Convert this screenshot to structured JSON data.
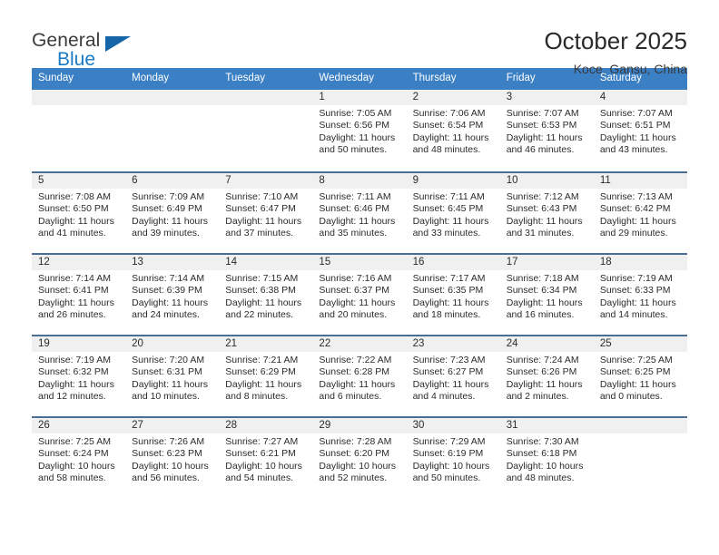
{
  "brand": {
    "line1": "General",
    "line2": "Blue",
    "triangle_color": "#1565a8",
    "blue_color": "#1b7ac4"
  },
  "header": {
    "title": "October 2025",
    "subtitle": "Koce, Gansu, China"
  },
  "theme": {
    "header_blue": "#3b7fc4",
    "row_divider": "#4a6f92",
    "daynum_band": "#f0f0f0"
  },
  "calendar": {
    "weekdays": [
      "Sunday",
      "Monday",
      "Tuesday",
      "Wednesday",
      "Thursday",
      "Friday",
      "Saturday"
    ],
    "weeks": [
      [
        {
          "day": "",
          "lines": []
        },
        {
          "day": "",
          "lines": []
        },
        {
          "day": "",
          "lines": []
        },
        {
          "day": "1",
          "lines": [
            "Sunrise: 7:05 AM",
            "Sunset: 6:56 PM",
            "Daylight: 11 hours",
            "and 50 minutes."
          ]
        },
        {
          "day": "2",
          "lines": [
            "Sunrise: 7:06 AM",
            "Sunset: 6:54 PM",
            "Daylight: 11 hours",
            "and 48 minutes."
          ]
        },
        {
          "day": "3",
          "lines": [
            "Sunrise: 7:07 AM",
            "Sunset: 6:53 PM",
            "Daylight: 11 hours",
            "and 46 minutes."
          ]
        },
        {
          "day": "4",
          "lines": [
            "Sunrise: 7:07 AM",
            "Sunset: 6:51 PM",
            "Daylight: 11 hours",
            "and 43 minutes."
          ]
        }
      ],
      [
        {
          "day": "5",
          "lines": [
            "Sunrise: 7:08 AM",
            "Sunset: 6:50 PM",
            "Daylight: 11 hours",
            "and 41 minutes."
          ]
        },
        {
          "day": "6",
          "lines": [
            "Sunrise: 7:09 AM",
            "Sunset: 6:49 PM",
            "Daylight: 11 hours",
            "and 39 minutes."
          ]
        },
        {
          "day": "7",
          "lines": [
            "Sunrise: 7:10 AM",
            "Sunset: 6:47 PM",
            "Daylight: 11 hours",
            "and 37 minutes."
          ]
        },
        {
          "day": "8",
          "lines": [
            "Sunrise: 7:11 AM",
            "Sunset: 6:46 PM",
            "Daylight: 11 hours",
            "and 35 minutes."
          ]
        },
        {
          "day": "9",
          "lines": [
            "Sunrise: 7:11 AM",
            "Sunset: 6:45 PM",
            "Daylight: 11 hours",
            "and 33 minutes."
          ]
        },
        {
          "day": "10",
          "lines": [
            "Sunrise: 7:12 AM",
            "Sunset: 6:43 PM",
            "Daylight: 11 hours",
            "and 31 minutes."
          ]
        },
        {
          "day": "11",
          "lines": [
            "Sunrise: 7:13 AM",
            "Sunset: 6:42 PM",
            "Daylight: 11 hours",
            "and 29 minutes."
          ]
        }
      ],
      [
        {
          "day": "12",
          "lines": [
            "Sunrise: 7:14 AM",
            "Sunset: 6:41 PM",
            "Daylight: 11 hours",
            "and 26 minutes."
          ]
        },
        {
          "day": "13",
          "lines": [
            "Sunrise: 7:14 AM",
            "Sunset: 6:39 PM",
            "Daylight: 11 hours",
            "and 24 minutes."
          ]
        },
        {
          "day": "14",
          "lines": [
            "Sunrise: 7:15 AM",
            "Sunset: 6:38 PM",
            "Daylight: 11 hours",
            "and 22 minutes."
          ]
        },
        {
          "day": "15",
          "lines": [
            "Sunrise: 7:16 AM",
            "Sunset: 6:37 PM",
            "Daylight: 11 hours",
            "and 20 minutes."
          ]
        },
        {
          "day": "16",
          "lines": [
            "Sunrise: 7:17 AM",
            "Sunset: 6:35 PM",
            "Daylight: 11 hours",
            "and 18 minutes."
          ]
        },
        {
          "day": "17",
          "lines": [
            "Sunrise: 7:18 AM",
            "Sunset: 6:34 PM",
            "Daylight: 11 hours",
            "and 16 minutes."
          ]
        },
        {
          "day": "18",
          "lines": [
            "Sunrise: 7:19 AM",
            "Sunset: 6:33 PM",
            "Daylight: 11 hours",
            "and 14 minutes."
          ]
        }
      ],
      [
        {
          "day": "19",
          "lines": [
            "Sunrise: 7:19 AM",
            "Sunset: 6:32 PM",
            "Daylight: 11 hours",
            "and 12 minutes."
          ]
        },
        {
          "day": "20",
          "lines": [
            "Sunrise: 7:20 AM",
            "Sunset: 6:31 PM",
            "Daylight: 11 hours",
            "and 10 minutes."
          ]
        },
        {
          "day": "21",
          "lines": [
            "Sunrise: 7:21 AM",
            "Sunset: 6:29 PM",
            "Daylight: 11 hours",
            "and 8 minutes."
          ]
        },
        {
          "day": "22",
          "lines": [
            "Sunrise: 7:22 AM",
            "Sunset: 6:28 PM",
            "Daylight: 11 hours",
            "and 6 minutes."
          ]
        },
        {
          "day": "23",
          "lines": [
            "Sunrise: 7:23 AM",
            "Sunset: 6:27 PM",
            "Daylight: 11 hours",
            "and 4 minutes."
          ]
        },
        {
          "day": "24",
          "lines": [
            "Sunrise: 7:24 AM",
            "Sunset: 6:26 PM",
            "Daylight: 11 hours",
            "and 2 minutes."
          ]
        },
        {
          "day": "25",
          "lines": [
            "Sunrise: 7:25 AM",
            "Sunset: 6:25 PM",
            "Daylight: 11 hours",
            "and 0 minutes."
          ]
        }
      ],
      [
        {
          "day": "26",
          "lines": [
            "Sunrise: 7:25 AM",
            "Sunset: 6:24 PM",
            "Daylight: 10 hours",
            "and 58 minutes."
          ]
        },
        {
          "day": "27",
          "lines": [
            "Sunrise: 7:26 AM",
            "Sunset: 6:23 PM",
            "Daylight: 10 hours",
            "and 56 minutes."
          ]
        },
        {
          "day": "28",
          "lines": [
            "Sunrise: 7:27 AM",
            "Sunset: 6:21 PM",
            "Daylight: 10 hours",
            "and 54 minutes."
          ]
        },
        {
          "day": "29",
          "lines": [
            "Sunrise: 7:28 AM",
            "Sunset: 6:20 PM",
            "Daylight: 10 hours",
            "and 52 minutes."
          ]
        },
        {
          "day": "30",
          "lines": [
            "Sunrise: 7:29 AM",
            "Sunset: 6:19 PM",
            "Daylight: 10 hours",
            "and 50 minutes."
          ]
        },
        {
          "day": "31",
          "lines": [
            "Sunrise: 7:30 AM",
            "Sunset: 6:18 PM",
            "Daylight: 10 hours",
            "and 48 minutes."
          ]
        },
        {
          "day": "",
          "lines": []
        }
      ]
    ]
  }
}
